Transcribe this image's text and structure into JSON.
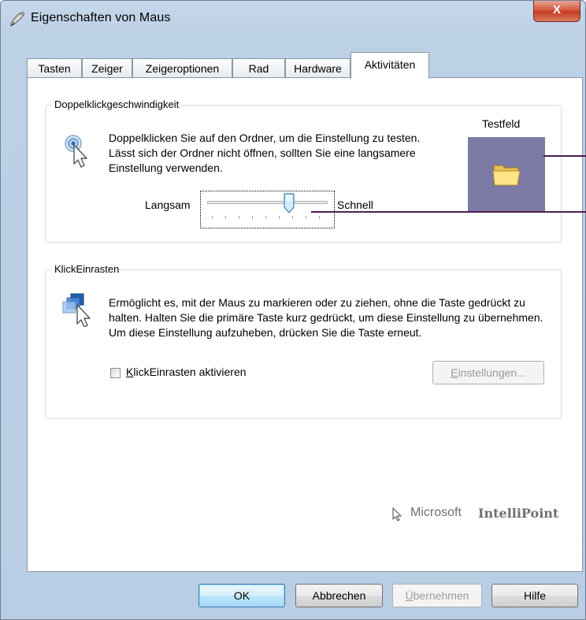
{
  "window": {
    "title": "Eigenschaften von Maus",
    "close_label": "X"
  },
  "tabs": [
    {
      "label": "Tasten"
    },
    {
      "label": "Zeiger"
    },
    {
      "label": "Zeigeroptionen"
    },
    {
      "label": "Rad"
    },
    {
      "label": "Hardware"
    },
    {
      "label": "Aktivitäten",
      "active": true
    }
  ],
  "doubleclick": {
    "group_title": "Doppelklickgeschwindigkeit",
    "description": "Doppelklicken Sie auf den Ordner, um die Einstellung zu testen. Lässt sich der Ordner nicht öffnen, sollten Sie eine langsamere Einstellung verwenden.",
    "test_label": "Testfeld",
    "slow_label": "Langsam",
    "fast_label": "Schnell",
    "slider_value_fraction": 0.68
  },
  "clicklock": {
    "group_title": "KlickEinrasten",
    "description": "Ermöglicht es, mit der Maus zu markieren oder zu ziehen, ohne die Taste gedrückt zu halten. Halten Sie die primäre Taste kurz gedrückt, um diese Einstellung zu übernehmen. Um diese Einstellung aufzuheben, drücken Sie die Taste erneut.",
    "checkbox_label_first": "K",
    "checkbox_label_rest": "lickEinrasten aktivieren",
    "checkbox_checked": false,
    "settings_first": "E",
    "settings_rest": "instellungen..."
  },
  "brand": {
    "prefix": "Microsoft",
    "name": "IntelliPoint"
  },
  "footer": {
    "ok": "OK",
    "cancel": "Abbrechen",
    "apply_first": "Ü",
    "apply_rest": "bernehmen",
    "help": "Hilfe"
  },
  "colors": {
    "folder_background": "#7b7ba6",
    "annotation_line": "#4d1d4f"
  }
}
